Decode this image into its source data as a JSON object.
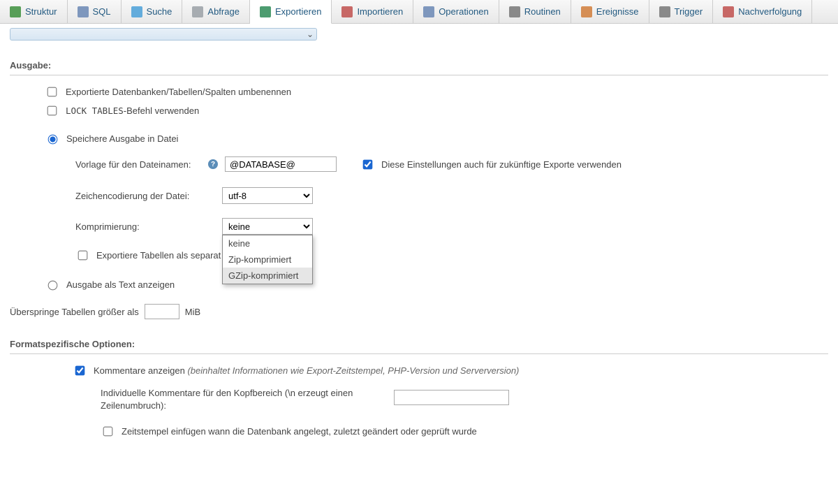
{
  "tabs": [
    {
      "label": "Struktur",
      "icon": "#3c8f3c"
    },
    {
      "label": "SQL",
      "icon": "#6a87b4"
    },
    {
      "label": "Suche",
      "icon": "#4aa0d8"
    },
    {
      "label": "Abfrage",
      "icon": "#9aa0a6"
    },
    {
      "label": "Exportieren",
      "icon": "#2e8b57",
      "active": true
    },
    {
      "label": "Importieren",
      "icon": "#c0504d"
    },
    {
      "label": "Operationen",
      "icon": "#6a87b4"
    },
    {
      "label": "Routinen",
      "icon": "#777"
    },
    {
      "label": "Ereignisse",
      "icon": "#d07c3a"
    },
    {
      "label": "Trigger",
      "icon": "#777"
    },
    {
      "label": "Nachverfolgung",
      "icon": "#c0504d"
    }
  ],
  "ausgabe": {
    "title": "Ausgabe:",
    "rename": "Exportierte Datenbanken/Tabellen/Spalten umbenennen",
    "lock_pre": "LOCK TABLES",
    "lock_post": "-Befehl verwenden",
    "save_file": "Speichere Ausgabe in Datei",
    "template_label": "Vorlage für den Dateinamen:",
    "template_value": "@DATABASE@",
    "remember": "Diese Einstellungen auch für zukünftige Exporte verwenden",
    "encoding_label": "Zeichencodierung der Datei:",
    "encoding_value": "utf-8",
    "compression_label": "Komprimierung:",
    "compression_value": "keine",
    "compression_options": [
      "keine",
      "Zip-komprimiert",
      "GZip-komprimiert"
    ],
    "compression_hover_index": 2,
    "separate_files": "Exportiere Tabellen als separat",
    "as_text": "Ausgabe als Text anzeigen"
  },
  "skip": {
    "label_pre": "Überspringe Tabellen größer als",
    "unit": "MiB",
    "value": ""
  },
  "format": {
    "title": "Formatspezifische Optionen:",
    "comments_label": "Kommentare anzeigen",
    "comments_note": "(beinhaltet Informationen wie Export-Zeitstempel, PHP-Version und Serverversion)",
    "header_comment_label": "Individuelle Kommentare für den Kopfbereich (\\n erzeugt einen Zeilenumbruch):",
    "header_comment_value": "",
    "timestamp_label": "Zeitstempel einfügen wann die Datenbank angelegt, zuletzt geändert oder geprüft wurde"
  }
}
